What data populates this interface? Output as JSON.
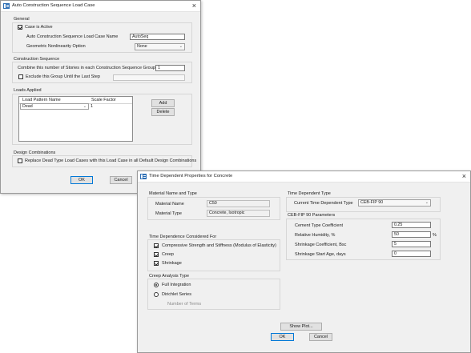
{
  "dialog1": {
    "title": "Auto Construction Sequence Load Case",
    "general": {
      "title": "General",
      "case_active_label": "Case is Active",
      "case_active_checked": true,
      "name_label": "Auto Construction Sequence Load Case Name",
      "name_value": "AutoSeq",
      "nonlinearity_label": "Geometric Nonlinearity Option",
      "nonlinearity_value": "None"
    },
    "sequence": {
      "title": "Construction Sequence",
      "stories_label": "Combine this number of Stories in each Construction Sequence Group",
      "stories_value": "1",
      "exclude_label": "Exclude this Group Until the Last Step",
      "exclude_checked": false
    },
    "loads": {
      "title": "Loads Applied",
      "col_pattern": "Load Pattern Name",
      "col_scale": "Scale Factor",
      "row_pattern": "Dead",
      "row_scale": "1",
      "add_label": "Add",
      "delete_label": "Delete"
    },
    "combos": {
      "title": "Design Combinations",
      "replace_label": "Replace Dead Type Load Cases with this Load Case in all Default Design Combinations",
      "replace_checked": false
    },
    "ok_label": "OK",
    "cancel_label": "Cancel"
  },
  "dialog2": {
    "title": "Time Dependent Properties for Concrete",
    "material": {
      "title": "Material Name and Type",
      "name_label": "Material Name",
      "name_value": "C50",
      "type_label": "Material Type",
      "type_value": "Concrete, Isotropic"
    },
    "time_dep_considered": {
      "title": "Time Dependence Considered For",
      "compressive_label": "Compressive Strength and Stiffness  (Modulus of Elasticity)",
      "compressive_checked": true,
      "creep_label": "Creep",
      "creep_checked": true,
      "shrinkage_label": "Shrinkage",
      "shrinkage_checked": true
    },
    "creep_analysis": {
      "title": "Creep Analysis Type",
      "full_label": "Full Integration",
      "full_selected": true,
      "dirichlet_label": "Dirichlet Series",
      "dirichlet_selected": false,
      "terms_label": "Number of Terms"
    },
    "time_dep_type": {
      "title": "Time Dependent Type",
      "current_label": "Current Time Dependent Type",
      "current_value": "CEB-FIP 90"
    },
    "params": {
      "title": "CEB-FIP 90 Parameters",
      "cement_label": "Cement Type Coefficient",
      "cement_value": "0.25",
      "humidity_label": "Relative Humidity, %",
      "humidity_value": "50",
      "humidity_unit": "%",
      "shrink_coef_label": "Shrinkage Coefficient, Bsc",
      "shrink_coef_value": "5",
      "shrink_age_label": "Shrinkage Start Age, days",
      "shrink_age_value": "0"
    },
    "show_plot_label": "Show Plot...",
    "ok_label": "OK",
    "cancel_label": "Cancel"
  },
  "colors": {
    "accent": "#0078d7",
    "dialog_bg": "#f0f0f0"
  },
  "icons": {
    "app": "etabs-app-icon",
    "close": "close-icon",
    "chevron": "chevron-down-icon"
  }
}
